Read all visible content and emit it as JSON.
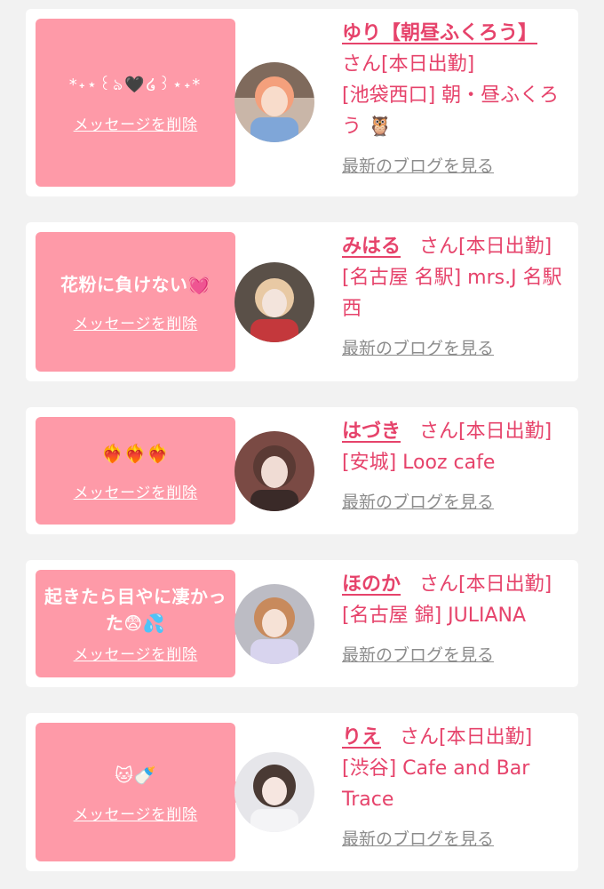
{
  "common": {
    "delete_label": "メッセージを削除",
    "blog_label": "最新のブログを見る",
    "accent_color": "#e6436b",
    "bubble_color": "#fe9aa8",
    "link_gray": "#8c8c8c"
  },
  "cards": [
    {
      "message": "*˖⋆꒰ঌ🖤໒꒱⋆˖*",
      "name": "ゆり【朝昼ふくろう】",
      "honorific": "さん",
      "status": "[本日出勤]",
      "shop": "[池袋西口] 朝・昼ふくろう 🦉"
    },
    {
      "message": "花粉に負けない💓",
      "name": "みはる",
      "honorific": "さん",
      "status": "[本日出勤]",
      "shop": "[名古屋 名駅] mrs.J 名駅西"
    },
    {
      "message": "❤️‍🔥❤️‍🔥❤️‍🔥",
      "name": "はづき",
      "honorific": "さん",
      "status": "[本日出勤]",
      "shop": "[安城] Looz cafe"
    },
    {
      "message": "起きたら目やに凄かった😨💦",
      "name": "ほのか",
      "honorific": "さん",
      "status": "[本日出勤]",
      "shop": "[名古屋 錦] JULIANA"
    },
    {
      "message": "🐱🍼",
      "name": "りえ",
      "honorific": "さん",
      "status": "[本日出勤]",
      "shop": "[渋谷] Cafe and Bar Trace"
    }
  ]
}
